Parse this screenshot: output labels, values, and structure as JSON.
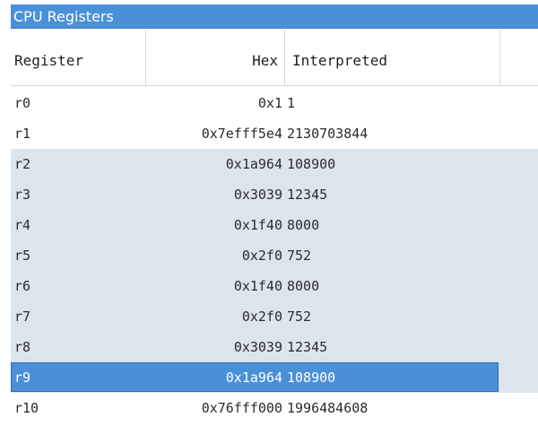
{
  "panel": {
    "title": "CPU Registers"
  },
  "columns": {
    "register": "Register",
    "hex": "Hex",
    "interpreted": "Interpreted"
  },
  "rows": [
    {
      "register": "r0",
      "hex": "0x1",
      "interpreted": "1"
    },
    {
      "register": "r1",
      "hex": "0x7efff5e4",
      "interpreted": "2130703844"
    },
    {
      "register": "r2",
      "hex": "0x1a964",
      "interpreted": "108900"
    },
    {
      "register": "r3",
      "hex": "0x3039",
      "interpreted": "12345"
    },
    {
      "register": "r4",
      "hex": "0x1f40",
      "interpreted": "8000"
    },
    {
      "register": "r5",
      "hex": "0x2f0",
      "interpreted": "752"
    },
    {
      "register": "r6",
      "hex": "0x1f40",
      "interpreted": "8000"
    },
    {
      "register": "r7",
      "hex": "0x2f0",
      "interpreted": "752"
    },
    {
      "register": "r8",
      "hex": "0x3039",
      "interpreted": "12345"
    },
    {
      "register": "r9",
      "hex": "0x1a964",
      "interpreted": "108900"
    },
    {
      "register": "r10",
      "hex": "0x76fff000",
      "interpreted": "1996484608"
    }
  ],
  "selected_register": "r9",
  "colors": {
    "title_bar": "#4a90d9",
    "selection": "#4a90d9",
    "changed_row": "#dce5ee"
  }
}
